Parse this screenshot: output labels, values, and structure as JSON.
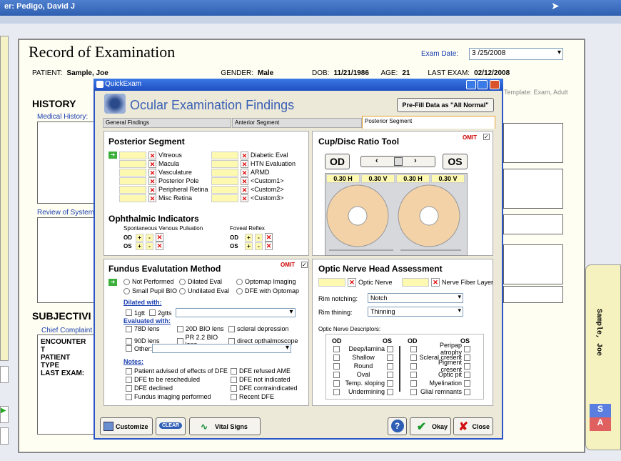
{
  "app": {
    "user_title": "er: Pedigo, David J"
  },
  "record": {
    "title": "Record of Examination",
    "exam_date_label": "Exam Date:",
    "exam_date": "3 /25/2008",
    "patient_label": "PATIENT:",
    "patient": "Sample, Joe",
    "gender_label": "GENDER:",
    "gender": "Male",
    "dob_label": "DOB:",
    "dob": "11/21/1986",
    "age_label": "AGE:",
    "age": "21",
    "last_exam_label": "LAST EXAM:",
    "last_exam": "02/12/2008",
    "template": "Template: Exam, Adult",
    "history": "HISTORY",
    "medical_history": "Medical History:",
    "review_of_systems": "Review of System",
    "subjective": "SUBJECTIVI",
    "chief_complaint": "Chief Complaint a",
    "encounter": "ENCOUNTER T",
    "patient_type": "PATIENT TYPE",
    "last_exam2": "LAST EXAM:",
    "sidebar_name": "Sample, Joe",
    "s_label": "S",
    "a_label": "A"
  },
  "dialog": {
    "title": "QuickExam",
    "heading": "Ocular Examination Findings",
    "prefill": "Pre-Fill Data as \"All Normal\"",
    "tabs": [
      "General Findings",
      "Anterior Segment",
      "Posterior Segment"
    ],
    "posterior": {
      "title": "Posterior Segment",
      "left": [
        "Vitreous",
        "Macula",
        "Vasculature",
        "Posterior Pole",
        "Peripheral Retina",
        "Misc Retina"
      ],
      "right": [
        "Diabetic Eval",
        "HTN Evaluation",
        "ARMD",
        "<Custom1>",
        "<Custom2>",
        "<Custom3>"
      ]
    },
    "ophth": {
      "title": "Ophthalmic Indicators",
      "svp": "Spontaneous Venous Pulsation",
      "foveal": "Foveal Reflex",
      "od": "OD",
      "os": "OS",
      "plus": "+",
      "minus": "-"
    },
    "cupdisc": {
      "title": "Cup/Disc Ratio Tool",
      "omit": "OMIT",
      "od": "OD",
      "os": "OS",
      "vals": [
        "0.30 H",
        "0.30 V",
        "0.30 H",
        "0.30 V"
      ]
    },
    "fundus": {
      "title": "Fundus Evalutation Method",
      "omit": "OMIT",
      "options": [
        "Not Performed",
        "Dilated Eval",
        "Optomap Imaging",
        "Small Pupil BIO",
        "Undilated Eval",
        "DFE with Optomap"
      ],
      "dilated_with": "Dilated with:",
      "dil_opts": [
        "1gtt",
        "2gtts"
      ],
      "evaluated_with": "Evaluated with:",
      "eval_opts": [
        "78D lens",
        "20D BIO lens",
        "scleral depression",
        "90D lens",
        "PR 2.2 BIO lens",
        "direct opthalmoscope"
      ],
      "other": "Other:",
      "notes": "Notes:",
      "notes_left": [
        "Patient advised of effects of DFE",
        "DFE to be rescheduled",
        "DFE declined",
        "Fundus imaging performed"
      ],
      "notes_right": [
        "DFE refused AME",
        "DFE not indicated",
        "DFE contraindicated",
        "Recent DFE"
      ]
    },
    "onh": {
      "title": "Optic Nerve Head Assessment",
      "optic_nerve": "Optic Nerve",
      "nfl": "Nerve Fiber Layer",
      "rim_notching": "Rim notching:",
      "notching_val": "Notch",
      "rim_thinning": "Rim thining:",
      "thinning_val": "Thinning",
      "descriptors": "Optic Nerve Descriptors:",
      "od": "OD",
      "os": "OS",
      "left_desc": [
        "Deep/lamina",
        "Shallow",
        "Round",
        "Oval",
        "Temp. sloping",
        "Undermining"
      ],
      "right_desc": [
        "Peripap atrophy",
        "Scleral cresent",
        "Pigment cresent",
        "Optic pit",
        "Myelination",
        "Glial remnants"
      ]
    },
    "buttons": {
      "customize": "Customize",
      "clear": "CLEAR",
      "vital": "Vital Signs",
      "help": "?",
      "okay": "Okay",
      "close": "Close"
    }
  }
}
